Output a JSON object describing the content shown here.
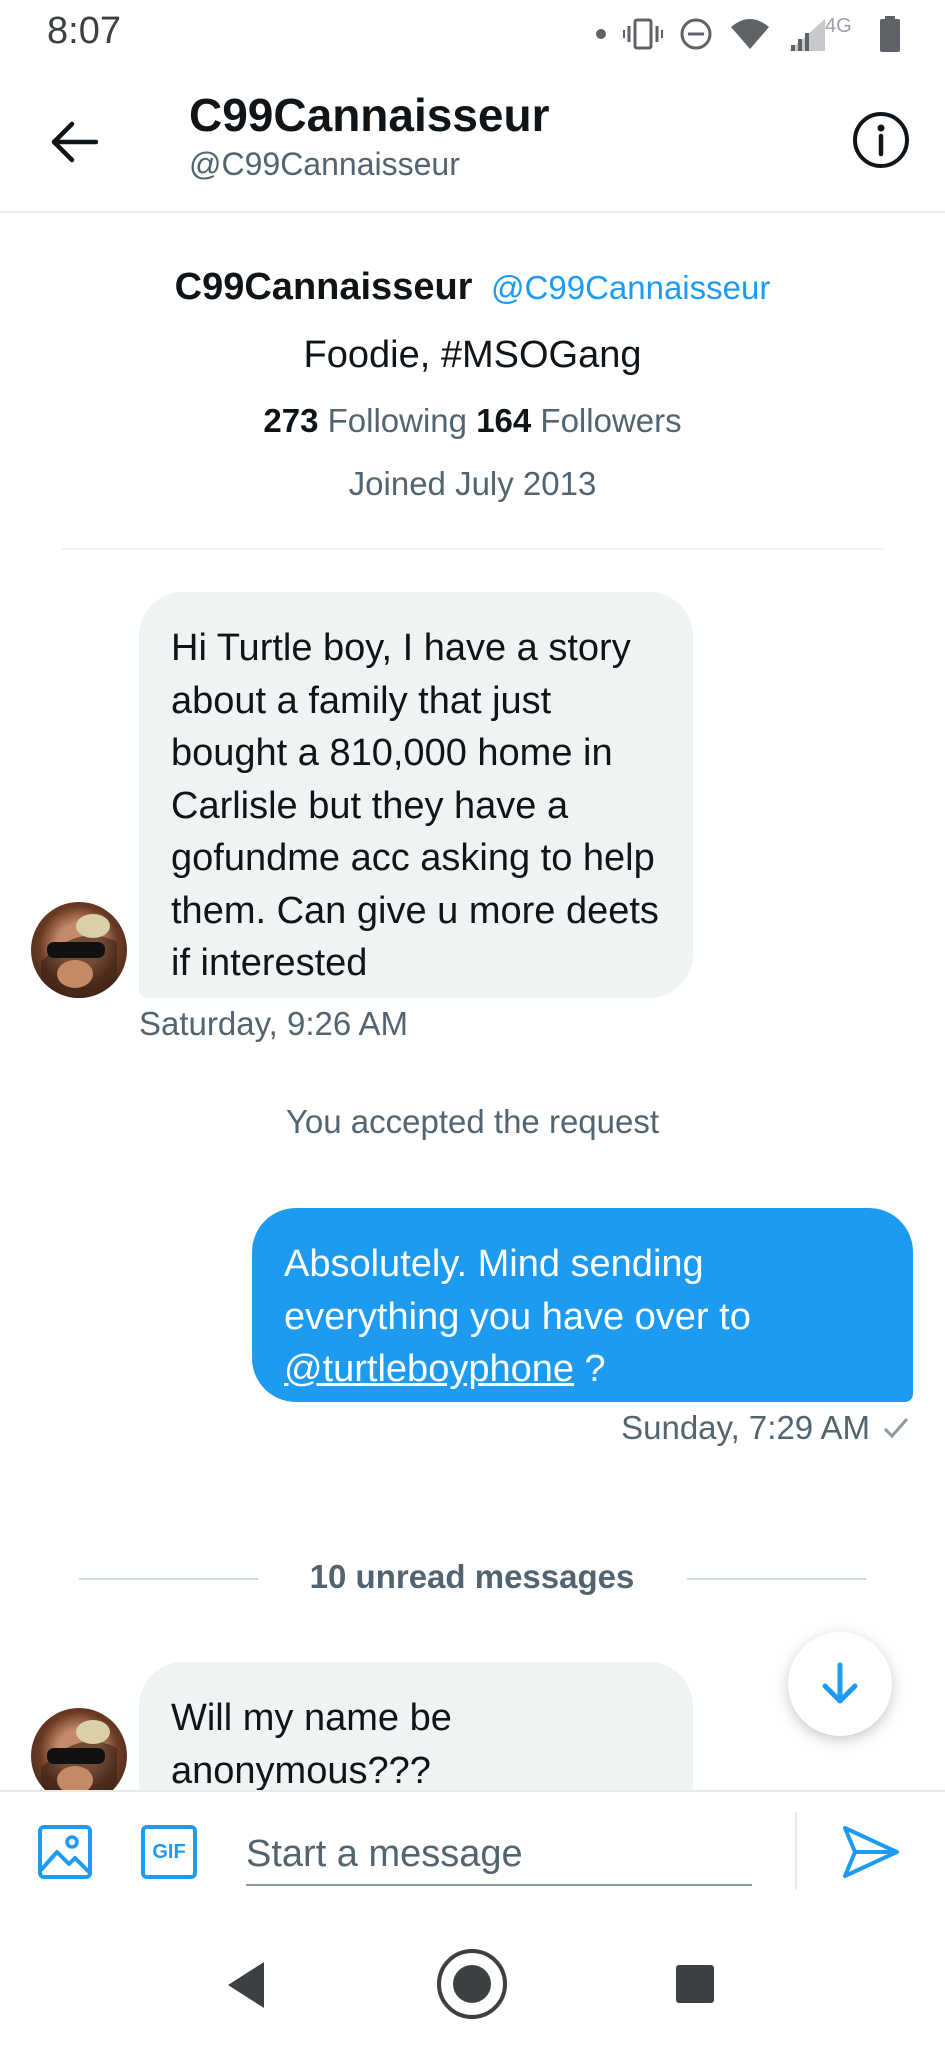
{
  "status_bar": {
    "time": "8:07",
    "network_label": "4G",
    "icons": [
      "dot-icon",
      "vibrate-icon",
      "do-not-disturb-icon",
      "wifi-icon",
      "signal-icon",
      "battery-icon"
    ]
  },
  "header": {
    "title": "C99Cannaisseur",
    "handle": "@C99Cannaisseur",
    "back_icon": "arrow-left-icon",
    "info_icon": "info-icon"
  },
  "profile": {
    "name": "C99Cannaisseur",
    "handle": "@C99Cannaisseur",
    "bio": "Foodie, #MSOGang",
    "following_count": "273",
    "following_label": "Following",
    "followers_count": "164",
    "followers_label": "Followers",
    "joined": "Joined July 2013"
  },
  "messages": [
    {
      "direction": "incoming",
      "text": "Hi Turtle boy, I have a story about a family that just bought a 810,000 home in Carlisle but they have a gofundme acc asking to help them.  Can give u more deets if interested",
      "timestamp": "Saturday, 9:26 AM"
    },
    {
      "direction": "system",
      "text": "You accepted the request"
    },
    {
      "direction": "outgoing",
      "text_before": "Absolutely. Mind sending everything you have over to ",
      "mention": "@turtleboyphone",
      "text_after": " ?",
      "timestamp": "Sunday, 7:29 AM",
      "status_icon": "check-icon"
    },
    {
      "direction": "incoming",
      "text": "Will my name be anonymous???"
    }
  ],
  "unread": {
    "label": "10 unread messages"
  },
  "composer": {
    "placeholder": "Start a message",
    "gif_label": "GIF",
    "icons": [
      "image-icon",
      "gif-icon",
      "send-icon"
    ]
  },
  "nav": {
    "icons": [
      "nav-back-icon",
      "nav-home-icon",
      "nav-recents-icon"
    ]
  },
  "colors": {
    "accent": "#1d9bf0",
    "incoming_bubble": "#eff3f4",
    "text_primary": "#0f1419",
    "text_secondary": "#536471"
  }
}
